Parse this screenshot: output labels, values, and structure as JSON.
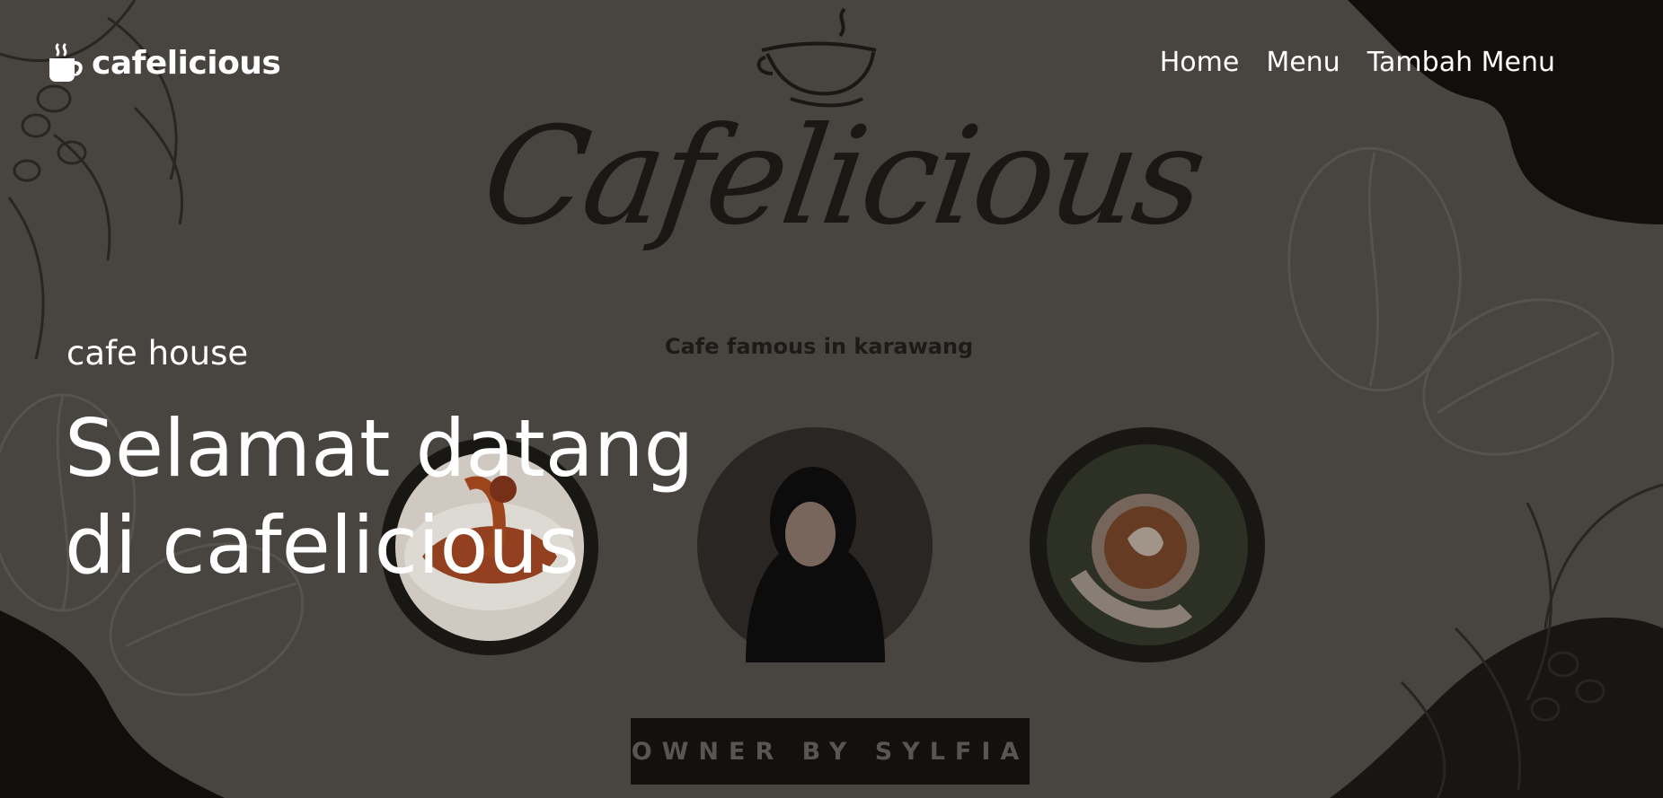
{
  "brand": {
    "name": "cafelicious",
    "icon": "coffee-cup-icon"
  },
  "nav": {
    "items": [
      "Home",
      "Menu",
      "Tambah Menu"
    ]
  },
  "hero": {
    "tagline": "cafe house",
    "headline_line1": "Selamat datang",
    "headline_line2": "di cafelicious"
  },
  "poster": {
    "script_title": "Cafelicious",
    "subtitle": "Cafe famous in karawang",
    "owner": "OWNER BY SYLFIA"
  },
  "colors": {
    "background": "#4b4844",
    "dark_corner": "#120f0d",
    "text": "#ffffff"
  }
}
